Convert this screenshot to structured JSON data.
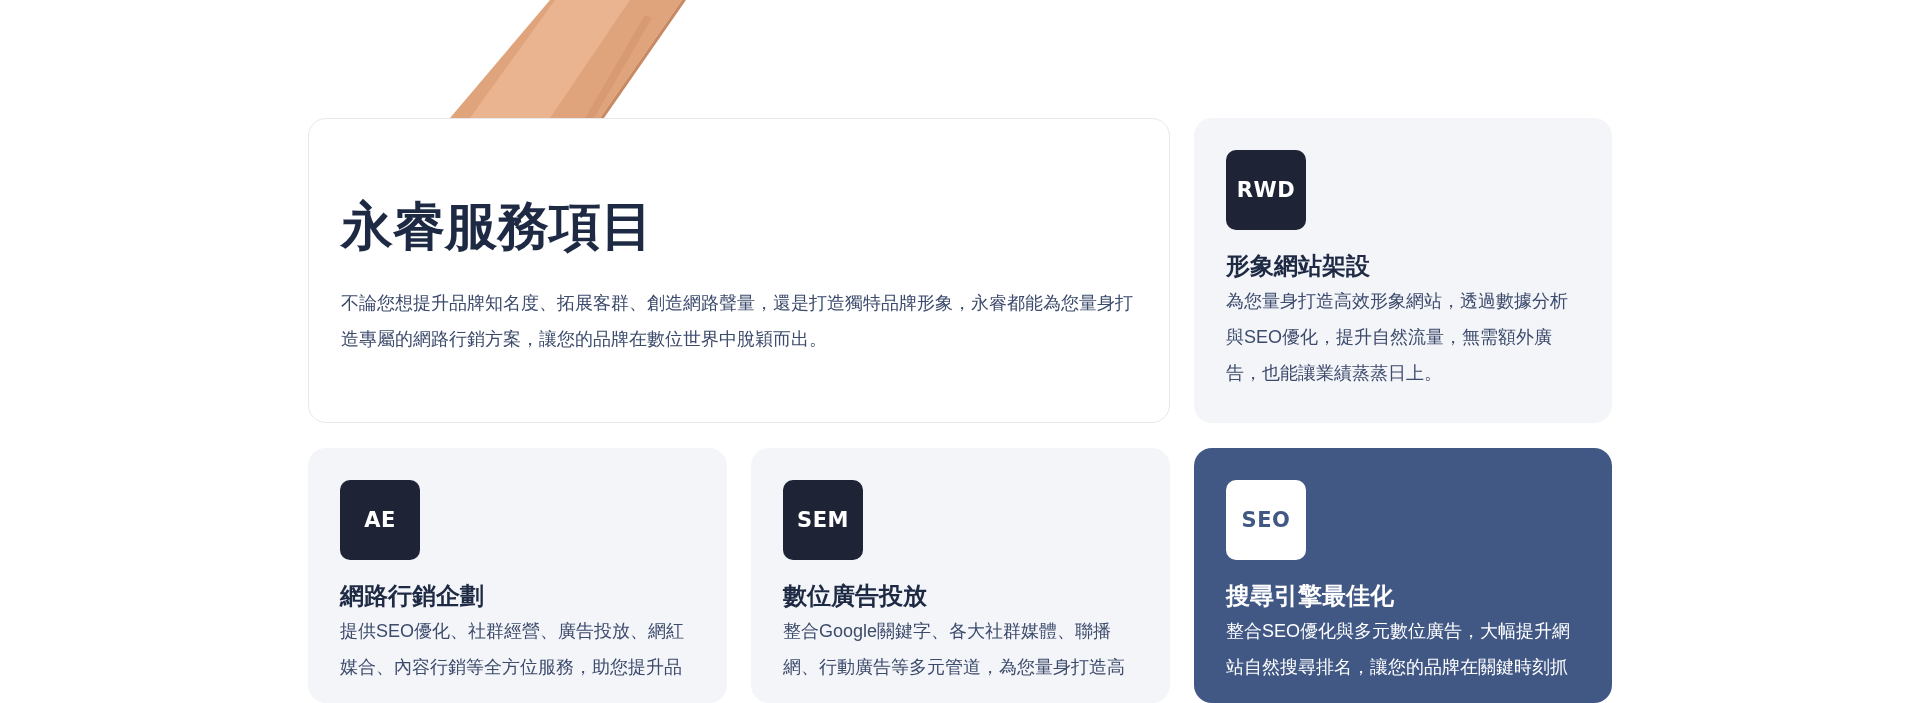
{
  "intro": {
    "title": "永睿服務項目",
    "description": "不論您想提升品牌知名度、拓展客群、創造網路聲量，還是打造獨特品牌形象，永睿都能為您量身打造專屬的網路行銷方案，讓您的品牌在數位世界中脫穎而出。"
  },
  "services": [
    {
      "badge": "RWD",
      "title": "形象網站架設",
      "description": "為您量身打造高效形象網站，透過數據分析與SEO優化，提升自然流量，無需額外廣告，也能讓業績蒸蒸日上。",
      "highlighted": false
    },
    {
      "badge": "AE",
      "title": "網路行銷企劃",
      "description": "提供SEO優化、社群經營、廣告投放、網紅媒合、內容行銷等全方位服務，助您提升品",
      "highlighted": false
    },
    {
      "badge": "SEM",
      "title": "數位廣告投放",
      "description": "整合Google關鍵字、各大社群媒體、聯播網、行動廣告等多元管道，為您量身打造高",
      "highlighted": false
    },
    {
      "badge": "SEO",
      "title": "搜尋引擎最佳化",
      "description": "整合SEO優化與多元數位廣告，大幅提升網站自然搜尋排名，讓您的品牌在關鍵時刻抓",
      "highlighted": true
    }
  ]
}
